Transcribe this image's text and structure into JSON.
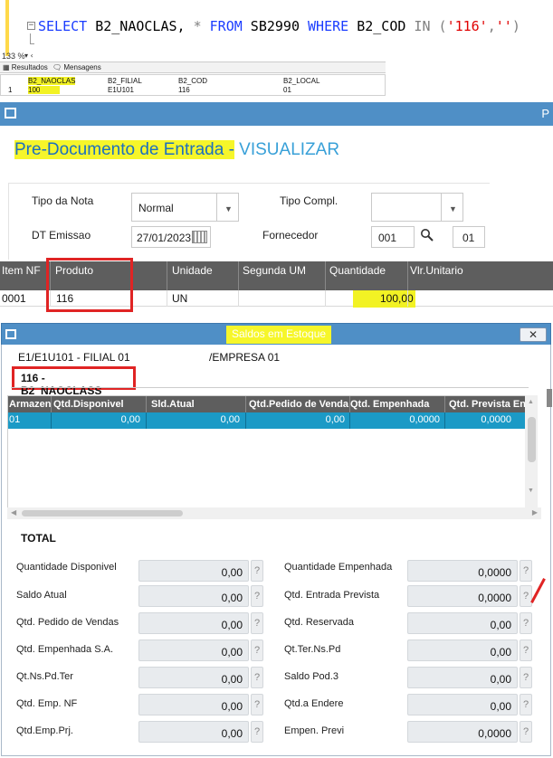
{
  "sql": {
    "query_parts": {
      "select": "SELECT",
      "field": " B2_NAOCLAS,",
      "star": " *",
      "from": " FROM",
      "table": " SB2990",
      "where": " WHERE",
      "cond": " B2_COD",
      "in": " IN",
      "open": " (",
      "val1": "'116'",
      "comma": ",",
      "val2": "''",
      "close": ")"
    },
    "zoom": "133 %",
    "tabs": [
      "Resultados",
      "Mensagens"
    ],
    "columns": [
      "B2_NAOCLAS",
      "B2_FILIAL",
      "B2_COD",
      "B2_LOCAL"
    ],
    "row_num": "1",
    "row": [
      "100",
      "E1U101",
      "116",
      "01"
    ]
  },
  "predoc": {
    "bar_letter": "P",
    "title_highlighted": "Pre-Documento de Entrada -",
    "title_mode": " VISUALIZAR",
    "fields": {
      "tipo_nota_label": "Tipo da Nota",
      "tipo_nota_value": "Normal",
      "tipo_compl_label": "Tipo Compl.",
      "tipo_compl_value": "",
      "dt_emissao_label": "DT Emissao",
      "dt_emissao_value": "27/01/2023",
      "fornecedor_label": "Fornecedor",
      "fornecedor_value": "001",
      "loja_value": "01"
    },
    "table": {
      "headers": [
        "Item NF",
        "Produto",
        "Unidade",
        "Segunda UM",
        "Quantidade",
        "Vlr.Unitario"
      ],
      "row": [
        "0001",
        "116",
        "UN",
        "",
        "100,00",
        ""
      ]
    }
  },
  "saldos": {
    "title": "Saldos em Estoque",
    "close_glyph": "✕",
    "filial": "E1/E1U101 - FILIAL 01",
    "empresa": "/EMPRESA 01",
    "product": "116 - B2_NAOCLASS",
    "grid": {
      "headers": [
        "Armazen",
        "Qtd.Disponivel",
        "Sld.Atual",
        "Qtd.Pedido de Venda",
        "Qtd. Empenhada",
        "Qtd. Prevista Ent"
      ],
      "row": [
        "01",
        "0,00",
        "0,00",
        "0,00",
        "0,0000",
        "0,0000"
      ]
    },
    "total_label": "TOTAL",
    "help_glyph": "?",
    "totals_left": [
      {
        "label": "Quantidade Disponivel",
        "value": "0,00"
      },
      {
        "label": "Saldo Atual",
        "value": "0,00"
      },
      {
        "label": "Qtd. Pedido de Vendas",
        "value": "0,00"
      },
      {
        "label": "Qtd. Empenhada S.A.",
        "value": "0,00"
      },
      {
        "label": "Qt.Ns.Pd.Ter",
        "value": "0,00"
      },
      {
        "label": "Qtd. Emp. NF",
        "value": "0,00"
      },
      {
        "label": "Qtd.Emp.Prj.",
        "value": "0,00"
      }
    ],
    "totals_right": [
      {
        "label": "Quantidade Empenhada",
        "value": "0,0000"
      },
      {
        "label": "Qtd. Entrada Prevista",
        "value": "0,0000"
      },
      {
        "label": "Qtd. Reservada",
        "value": "0,00"
      },
      {
        "label": "Qt.Ter.Ns.Pd",
        "value": "0,00"
      },
      {
        "label": "Saldo Pod.3",
        "value": "0,00"
      },
      {
        "label": "Qtd.a Endere",
        "value": "0,00"
      },
      {
        "label": "Empen. Previ",
        "value": "0,0000"
      }
    ]
  },
  "colors": {
    "titlebar": "#4f8fc6",
    "highlight": "#f6f62a",
    "selected_row": "#1b9ac6",
    "annotation_red": "#e02424"
  }
}
